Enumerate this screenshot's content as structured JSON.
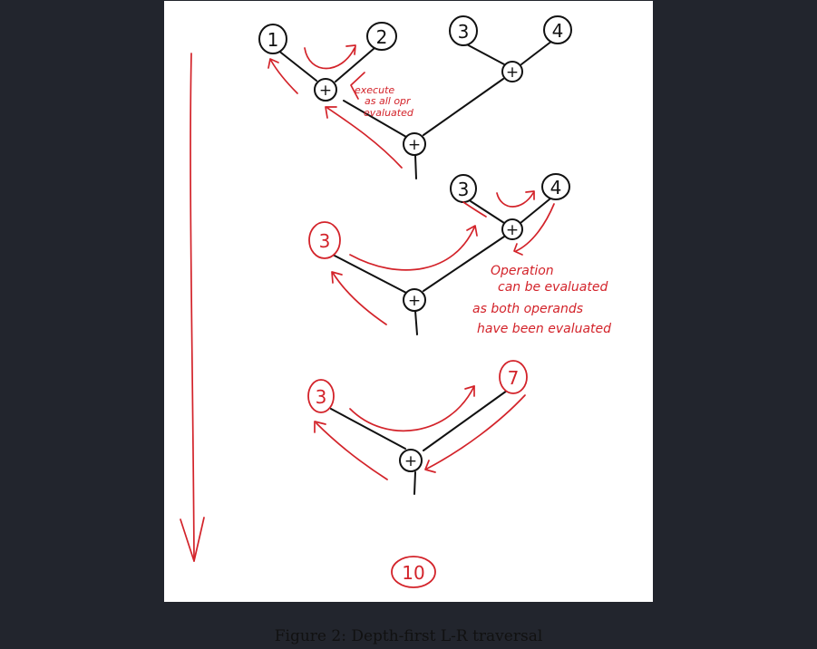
{
  "figure": {
    "caption": "Figure 2: Depth-first L-R traversal",
    "colors": {
      "ink": "#111111",
      "annotation": "#d3232a",
      "background": "#22252d",
      "panel": "#ffffff"
    },
    "stage1": {
      "leaf_a": "1",
      "leaf_b": "2",
      "leaf_c": "3",
      "leaf_d": "4",
      "op_left": "+",
      "op_right": "+",
      "op_root": "+",
      "note_line1": "execute",
      "note_line2": "as all opr",
      "note_line3": "evaluated"
    },
    "stage2": {
      "left_value": "3",
      "leaf_c": "3",
      "leaf_d": "4",
      "op_right": "+",
      "op_root": "+",
      "note_line1": "Operation",
      "note_line2": "can be evaluated",
      "note_line3": "as both operands",
      "note_line4": "have been evaluated"
    },
    "stage3": {
      "left_value": "3",
      "right_value": "7",
      "op_root": "+"
    },
    "stage4": {
      "result": "10"
    }
  }
}
